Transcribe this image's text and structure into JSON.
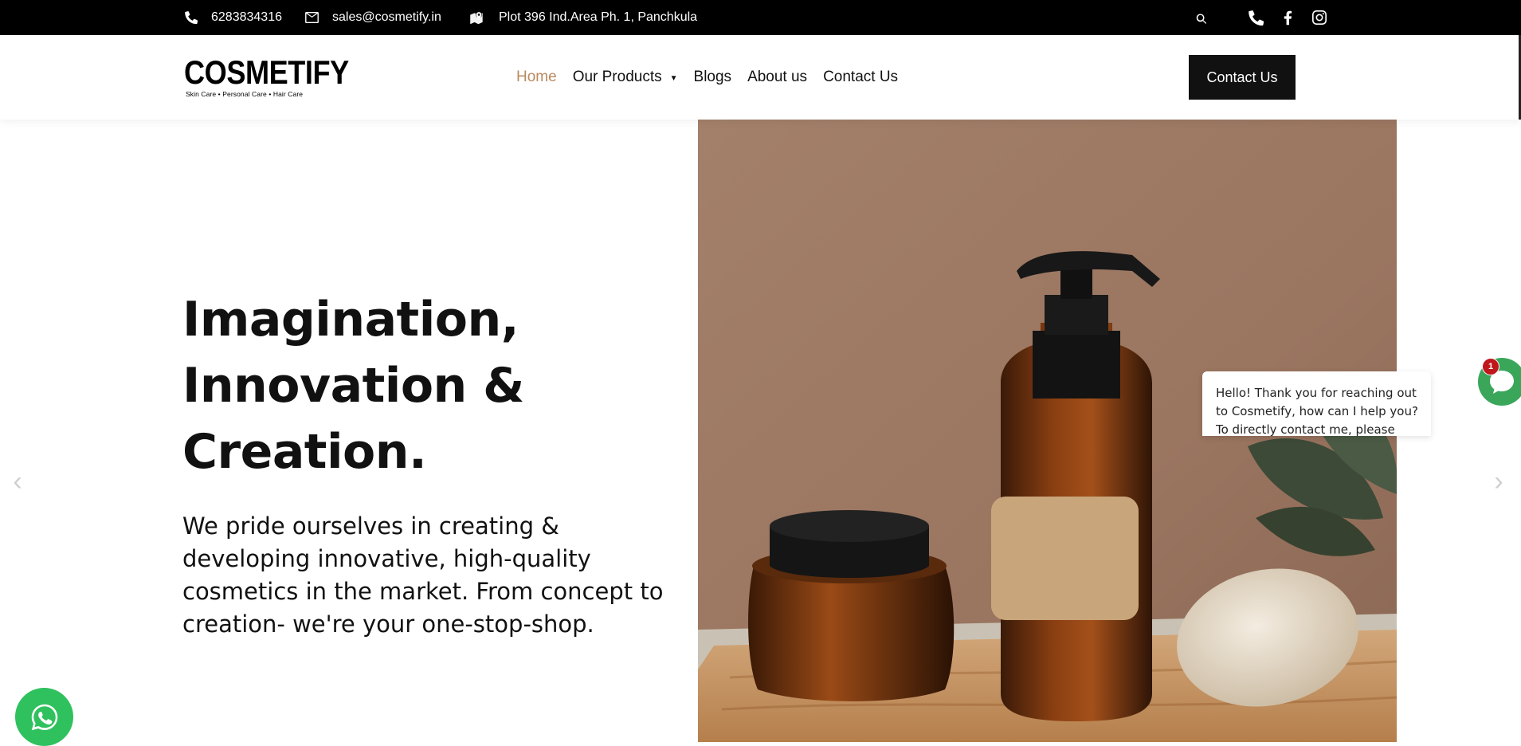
{
  "topbar": {
    "phone": "6283834316",
    "email": "sales@cosmetify.in",
    "address": "Plot 396 Ind.Area Ph. 1, Panchkula",
    "icons": [
      "phone-icon",
      "envelope-icon",
      "map-icon",
      "search-icon",
      "phone-icon",
      "facebook-icon",
      "instagram-icon"
    ]
  },
  "header": {
    "logo": "COSMETIFY",
    "tagline": "Skin Care • Personal Care • Hair Care",
    "nav": [
      {
        "label": "Home",
        "active": true
      },
      {
        "label": "Our Products",
        "dropdown": true
      },
      {
        "label": "Blogs"
      },
      {
        "label": "About us"
      },
      {
        "label": "Contact Us"
      }
    ],
    "cta": "Contact Us"
  },
  "hero": {
    "title_lines": [
      "Imagination,",
      "Innovation &",
      "Creation."
    ],
    "subtitle": "We pride ourselves in creating & developing innovative, high-quality cosmetics in the market. From concept to creation- we're your one-stop-shop."
  },
  "chat": {
    "message": "Hello! Thank you for reaching out to Cosmetify, how can I help you? To directly contact me, please feel free",
    "badge": "1"
  },
  "colors": {
    "topbar_bg": "#000000",
    "active_nav": "#b98a5f",
    "cta_bg": "#111111",
    "chat_green": "#3aa65a",
    "whatsapp_green": "#2fc15e",
    "badge_red": "#c0171c"
  }
}
